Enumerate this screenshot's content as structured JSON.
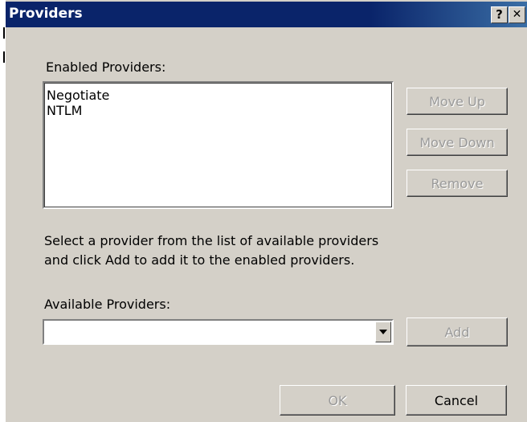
{
  "window": {
    "title": "Providers",
    "help_glyph": "?",
    "close_glyph": "✕"
  },
  "enabled": {
    "label": "Enabled Providers:",
    "items": [
      "Negotiate",
      "NTLM"
    ]
  },
  "side_buttons": {
    "move_up": "Move Up",
    "move_down": "Move Down",
    "remove": "Remove"
  },
  "instructions": {
    "line1": "Select a provider from the list of available providers",
    "line2": "and click Add to add it to the enabled providers."
  },
  "available": {
    "label": "Available Providers:",
    "value": "",
    "add_label": "Add"
  },
  "footer": {
    "ok_label": "OK",
    "cancel_label": "Cancel"
  },
  "colors": {
    "titlebar": "#0a246a",
    "dialog_bg": "#d4d0c8",
    "disabled_text": "#9a9a9a"
  }
}
